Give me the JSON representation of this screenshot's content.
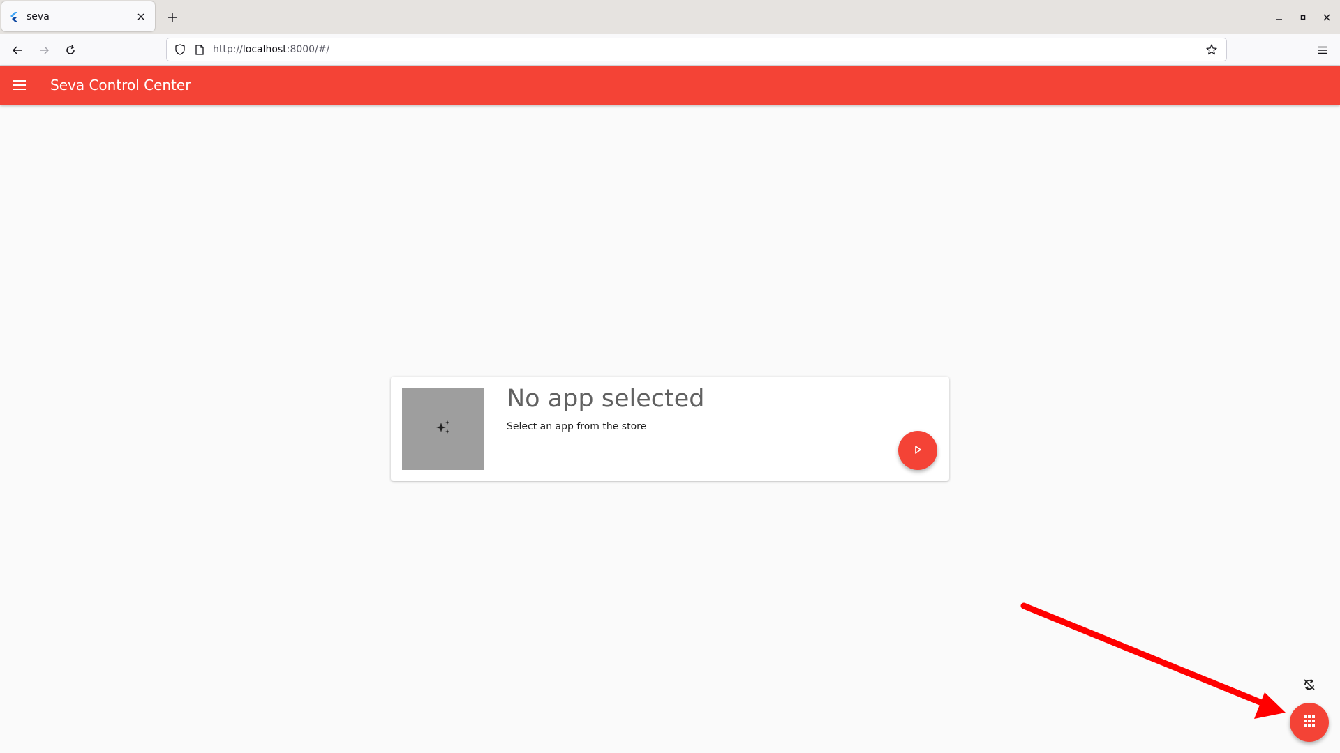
{
  "browser": {
    "tab": {
      "title": "seva",
      "favicon": "flutter-icon"
    },
    "url": {
      "scheme": "http://",
      "host": "localhost",
      "rest": ":8000/#/"
    }
  },
  "app": {
    "title": "Seva Control Center",
    "card": {
      "title": "No app selected",
      "subtitle": "Select an app from the store"
    }
  },
  "colors": {
    "primary": "#f44336",
    "thumbnail": "#9e9e9e",
    "annotation_arrow": "#ff0000"
  },
  "icons": {
    "menu": "hamburger-icon",
    "thumbnail": "sparkle-icon",
    "play": "play-icon",
    "sync": "sync-disabled-icon",
    "apps": "apps-grid-icon"
  }
}
